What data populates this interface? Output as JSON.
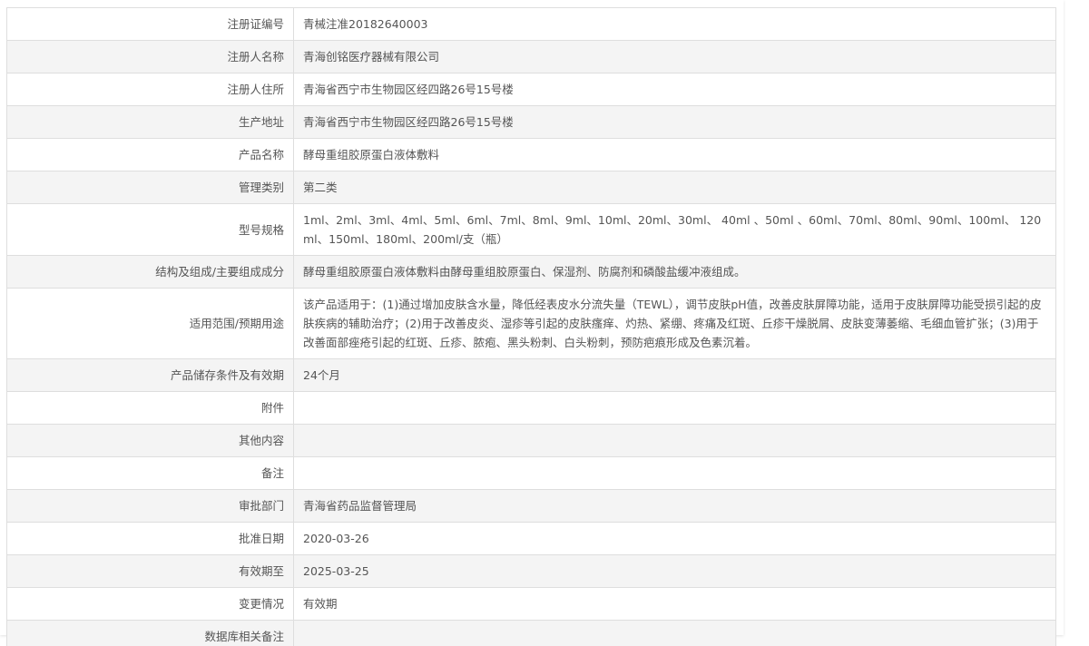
{
  "rows": [
    {
      "label": "注册证编号",
      "value": "青械注准20182640003"
    },
    {
      "label": "注册人名称",
      "value": "青海创铭医疗器械有限公司"
    },
    {
      "label": "注册人住所",
      "value": "青海省西宁市生物园区经四路26号15号楼"
    },
    {
      "label": "生产地址",
      "value": "青海省西宁市生物园区经四路26号15号楼"
    },
    {
      "label": "产品名称",
      "value": "酵母重组胶原蛋白液体敷料"
    },
    {
      "label": "管理类别",
      "value": "第二类"
    },
    {
      "label": "型号规格",
      "value": "1ml、2ml、3ml、4ml、5ml、6ml、7ml、8ml、9ml、10ml、20ml、30ml、 40ml 、50ml 、60ml、70ml、80ml、90ml、100ml、 120ml、150ml、180ml、200ml/支（瓶）"
    },
    {
      "label": "结构及组成/主要组成成分",
      "value": "酵母重组胶原蛋白液体敷料由酵母重组胶原蛋白、保湿剂、防腐剂和磷酸盐缓冲液组成。"
    },
    {
      "label": "适用范围/预期用途",
      "value": "该产品适用于：(1)通过增加皮肤含水量，降低经表皮水分流失量（TEWL），调节皮肤pH值，改善皮肤屏障功能，适用于皮肤屏障功能受损引起的皮肤疾病的辅助治疗；(2)用于改善皮炎、湿疹等引起的皮肤瘙痒、灼热、紧绷、疼痛及红斑、丘疹干燥脱屑、皮肤变薄萎缩、毛细血管扩张；(3)用于改善面部痤疮引起的红斑、丘疹、脓疱、黑头粉刺、白头粉刺，预防疤痕形成及色素沉着。"
    },
    {
      "label": "产品储存条件及有效期",
      "value": "24个月"
    },
    {
      "label": "附件",
      "value": ""
    },
    {
      "label": "其他内容",
      "value": ""
    },
    {
      "label": "备注",
      "value": ""
    },
    {
      "label": "审批部门",
      "value": "青海省药品监督管理局"
    },
    {
      "label": "批准日期",
      "value": "2020-03-26"
    },
    {
      "label": "有效期至",
      "value": "2025-03-25"
    },
    {
      "label": "变更情况",
      "value": "有效期"
    },
    {
      "label": "数据库相关备注",
      "value": ""
    }
  ]
}
